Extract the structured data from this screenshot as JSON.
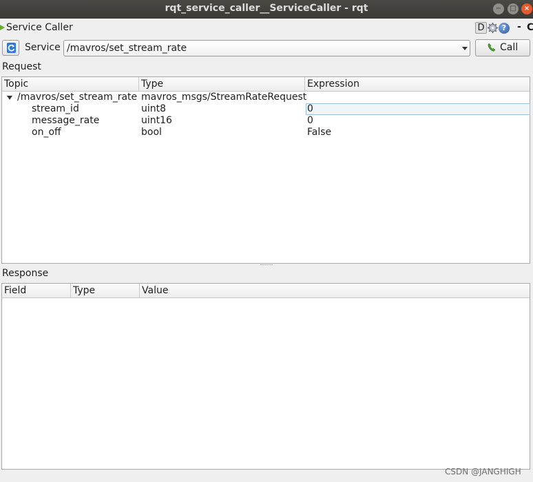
{
  "window": {
    "title": "rqt_service_caller__ServiceCaller - rqt",
    "min_glyph": "−",
    "max_glyph": "□",
    "close_glyph": "×"
  },
  "plugin": {
    "title": "Service Caller",
    "d_label": "D",
    "help_glyph": "?",
    "dash": "-",
    "close_glyph": "C"
  },
  "service": {
    "label": "Service",
    "value": "/mavros/set_stream_rate",
    "call_label": "Call"
  },
  "request": {
    "label": "Request",
    "headers": [
      "Topic",
      "Type",
      "Expression"
    ],
    "root": {
      "topic": "/mavros/set_stream_rate",
      "type": "mavros_msgs/StreamRateRequest",
      "expression": ""
    },
    "fields": [
      {
        "topic": "stream_id",
        "type": "uint8",
        "expression": "0"
      },
      {
        "topic": "message_rate",
        "type": "uint16",
        "expression": "0"
      },
      {
        "topic": "on_off",
        "type": "bool",
        "expression": "False"
      }
    ]
  },
  "response": {
    "label": "Response",
    "headers": [
      "Field",
      "Type",
      "Value"
    ]
  },
  "watermark": "CSDN @JANGHIGH",
  "icons": {
    "refresh": "refresh-icon",
    "call": "phone-icon",
    "settings": "gear-icon",
    "help": "help-icon"
  }
}
